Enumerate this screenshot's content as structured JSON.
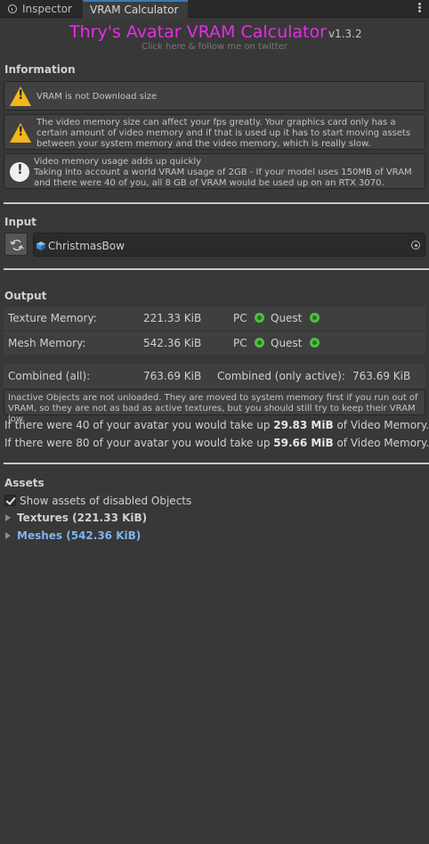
{
  "tabs": [
    {
      "label": "Inspector",
      "icon": "info-icon"
    },
    {
      "label": "VRAM Calculator",
      "active": true
    }
  ],
  "header": {
    "title": "Thry's Avatar VRAM Calculator",
    "version": "v1.3.2",
    "subtitle": "Click here & follow me on twitter"
  },
  "information": {
    "heading": "Information",
    "messages": [
      {
        "type": "warning",
        "icon": "warning-icon",
        "text": "VRAM is not Download size"
      },
      {
        "type": "warning",
        "icon": "warning-icon",
        "text": "The video memory size can affect your fps greatly. Your graphics card only has a certain amount of video memory and if that is used up it has to start moving assets between your system memory and the video memory, which is really slow."
      },
      {
        "type": "info",
        "icon": "info-icon",
        "text": "Video memory usage adds up quickly\nTaking into account a world VRAM usage of 2GB - If your model uses 150MB of VRAM and there were 40 of you, all 8 GB of VRAM would be used up on an RTX 3070."
      }
    ]
  },
  "input": {
    "heading": "Input",
    "object_value": "ChristmasBow",
    "refresh_icon": "refresh-icon",
    "picker_icon": "object-picker-icon"
  },
  "output": {
    "heading": "Output",
    "rows": [
      {
        "label": "Texture Memory:",
        "value": "221.33 KiB",
        "pc": "PC",
        "quest": "Quest"
      },
      {
        "label": "Mesh Memory:",
        "value": "542.36 KiB",
        "pc": "PC",
        "quest": "Quest"
      }
    ],
    "combined_label": "Combined (all):",
    "combined_value": "763.69 KiB",
    "combined_active_label": "Combined (only active):",
    "combined_active_value": "763.69 KiB",
    "note": "Inactive Objects are not unloaded. They are moved to system memory first if you run out of VRAM, so they are not as bad as active textures, but you should still try to keep their VRAM low.",
    "line40": {
      "pre": "If there were 40 of your avatar you would take up ",
      "value": "29.83 MiB",
      "post": " of Video Memory."
    },
    "line80": {
      "pre": "If there were 80 of your avatar you would take up ",
      "value": "59.66 MiB",
      "post": " of Video Memory."
    },
    "status_color": "#4fc041"
  },
  "assets": {
    "heading": "Assets",
    "show_disabled_label": "Show assets of disabled Objects",
    "show_disabled_checked": true,
    "textures_label": "Textures  (221.33 KiB)",
    "meshes_label": "Meshes  (542.36 KiB)"
  },
  "colors": {
    "title": "#e52ee6",
    "accent": "#3a79bb",
    "meshes_link": "#7fb3f0",
    "warning": "#f3b71a"
  }
}
